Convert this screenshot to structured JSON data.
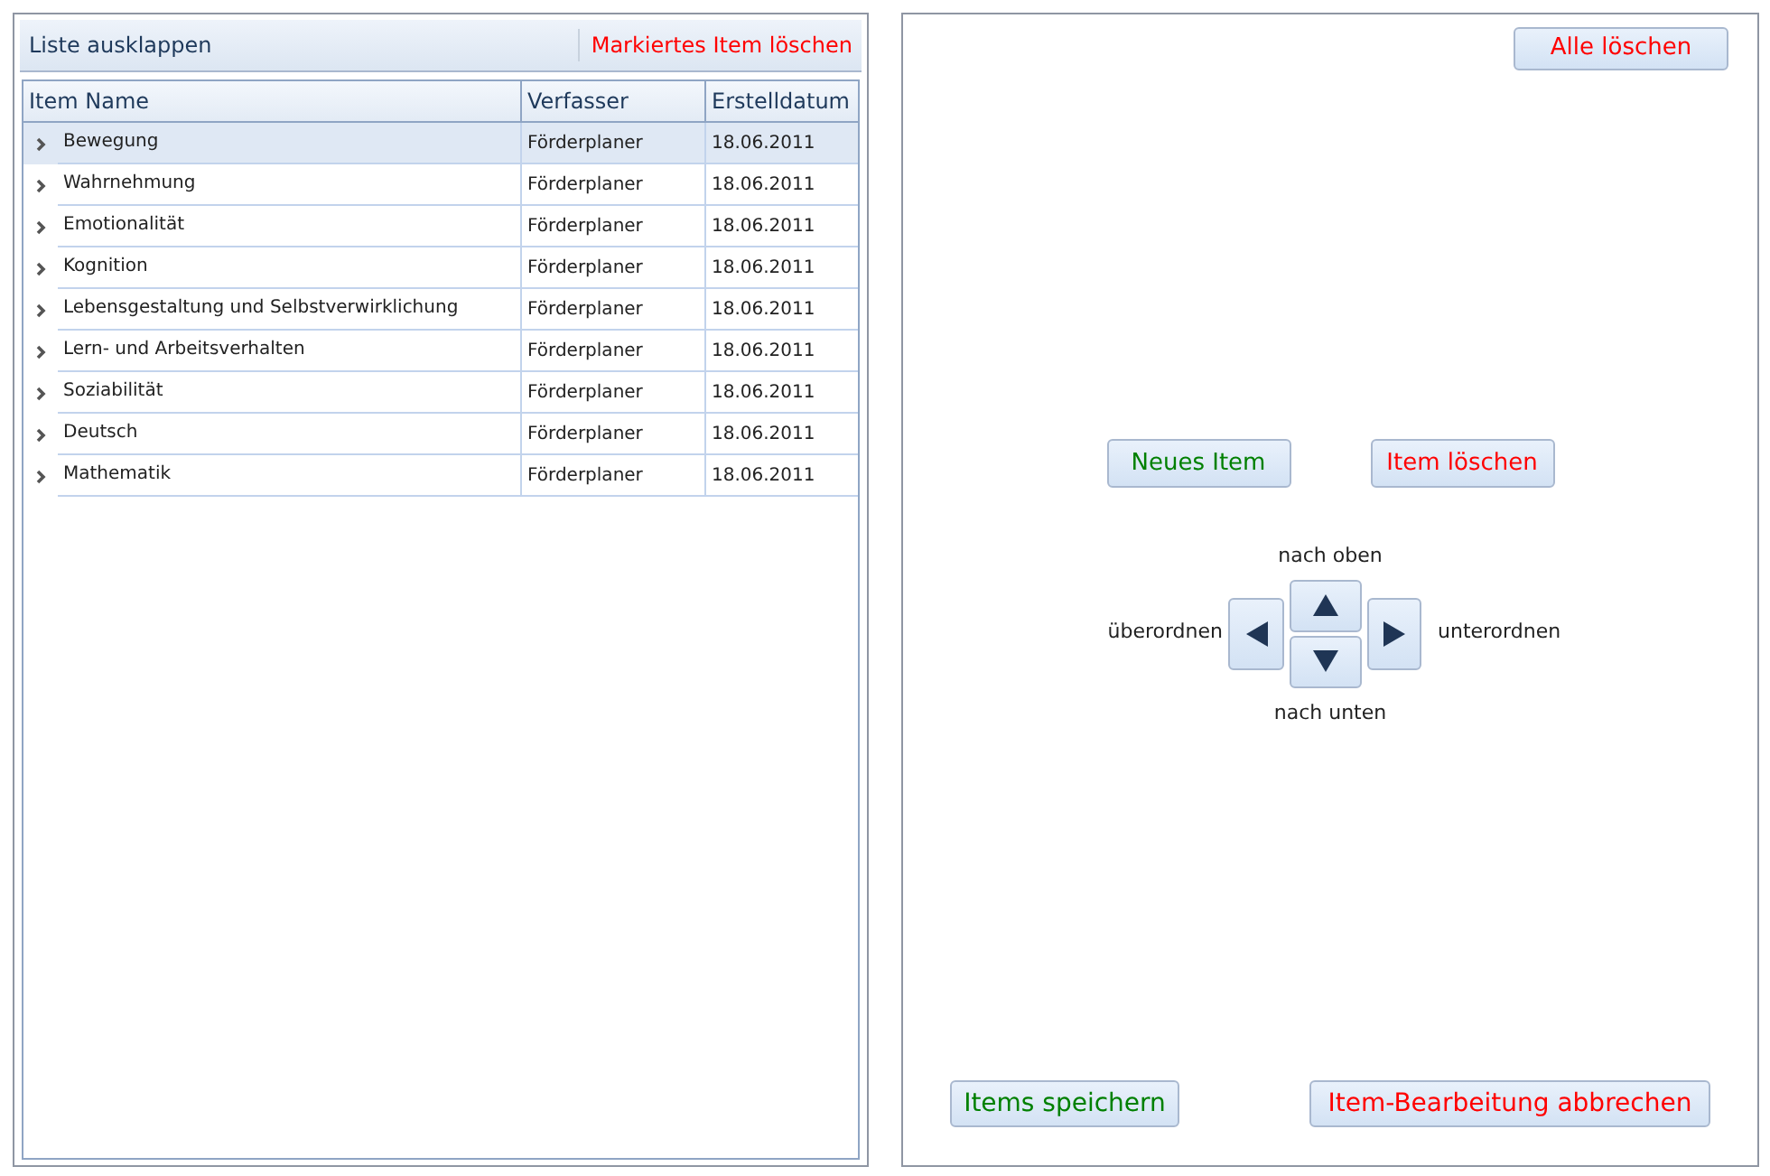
{
  "toolbar": {
    "expand_link": "Liste ausklappen",
    "delete_link": "Markiertes Item löschen"
  },
  "table": {
    "columns": [
      "Item Name",
      "Verfasser",
      "Erstelldatum"
    ],
    "rows": [
      {
        "name": "Bewegung",
        "author": "Förderplaner",
        "date": "18.06.2011",
        "selected": true
      },
      {
        "name": "Wahrnehmung",
        "author": "Förderplaner",
        "date": "18.06.2011",
        "selected": false
      },
      {
        "name": "Emotionalität",
        "author": "Förderplaner",
        "date": "18.06.2011",
        "selected": false
      },
      {
        "name": "Kognition",
        "author": "Förderplaner",
        "date": "18.06.2011",
        "selected": false
      },
      {
        "name": "Lebensgestaltung und Selbstverwirklichung",
        "author": "Förderplaner",
        "date": "18.06.2011",
        "selected": false
      },
      {
        "name": "Lern- und Arbeitsverhalten",
        "author": "Förderplaner",
        "date": "18.06.2011",
        "selected": false
      },
      {
        "name": "Soziabilität",
        "author": "Förderplaner",
        "date": "18.06.2011",
        "selected": false
      },
      {
        "name": "Deutsch",
        "author": "Förderplaner",
        "date": "18.06.2011",
        "selected": false
      },
      {
        "name": "Mathematik",
        "author": "Förderplaner",
        "date": "18.06.2011",
        "selected": false
      }
    ]
  },
  "editor": {
    "clear_all": {
      "label": "Alle löschen",
      "color": "#ff0000"
    },
    "new_item": {
      "label": "Neues Item",
      "color": "#008000"
    },
    "delete_item": {
      "label": "Item löschen",
      "color": "#ff0000"
    },
    "move": {
      "up": "nach oben",
      "down": "nach unten",
      "promote": "überordnen",
      "demote": "unterordnen"
    },
    "save": {
      "label": "Items speichern",
      "color": "#008000"
    },
    "cancel": {
      "label": "Item-Bearbeitung abbrechen",
      "color": "#ff0000"
    }
  }
}
